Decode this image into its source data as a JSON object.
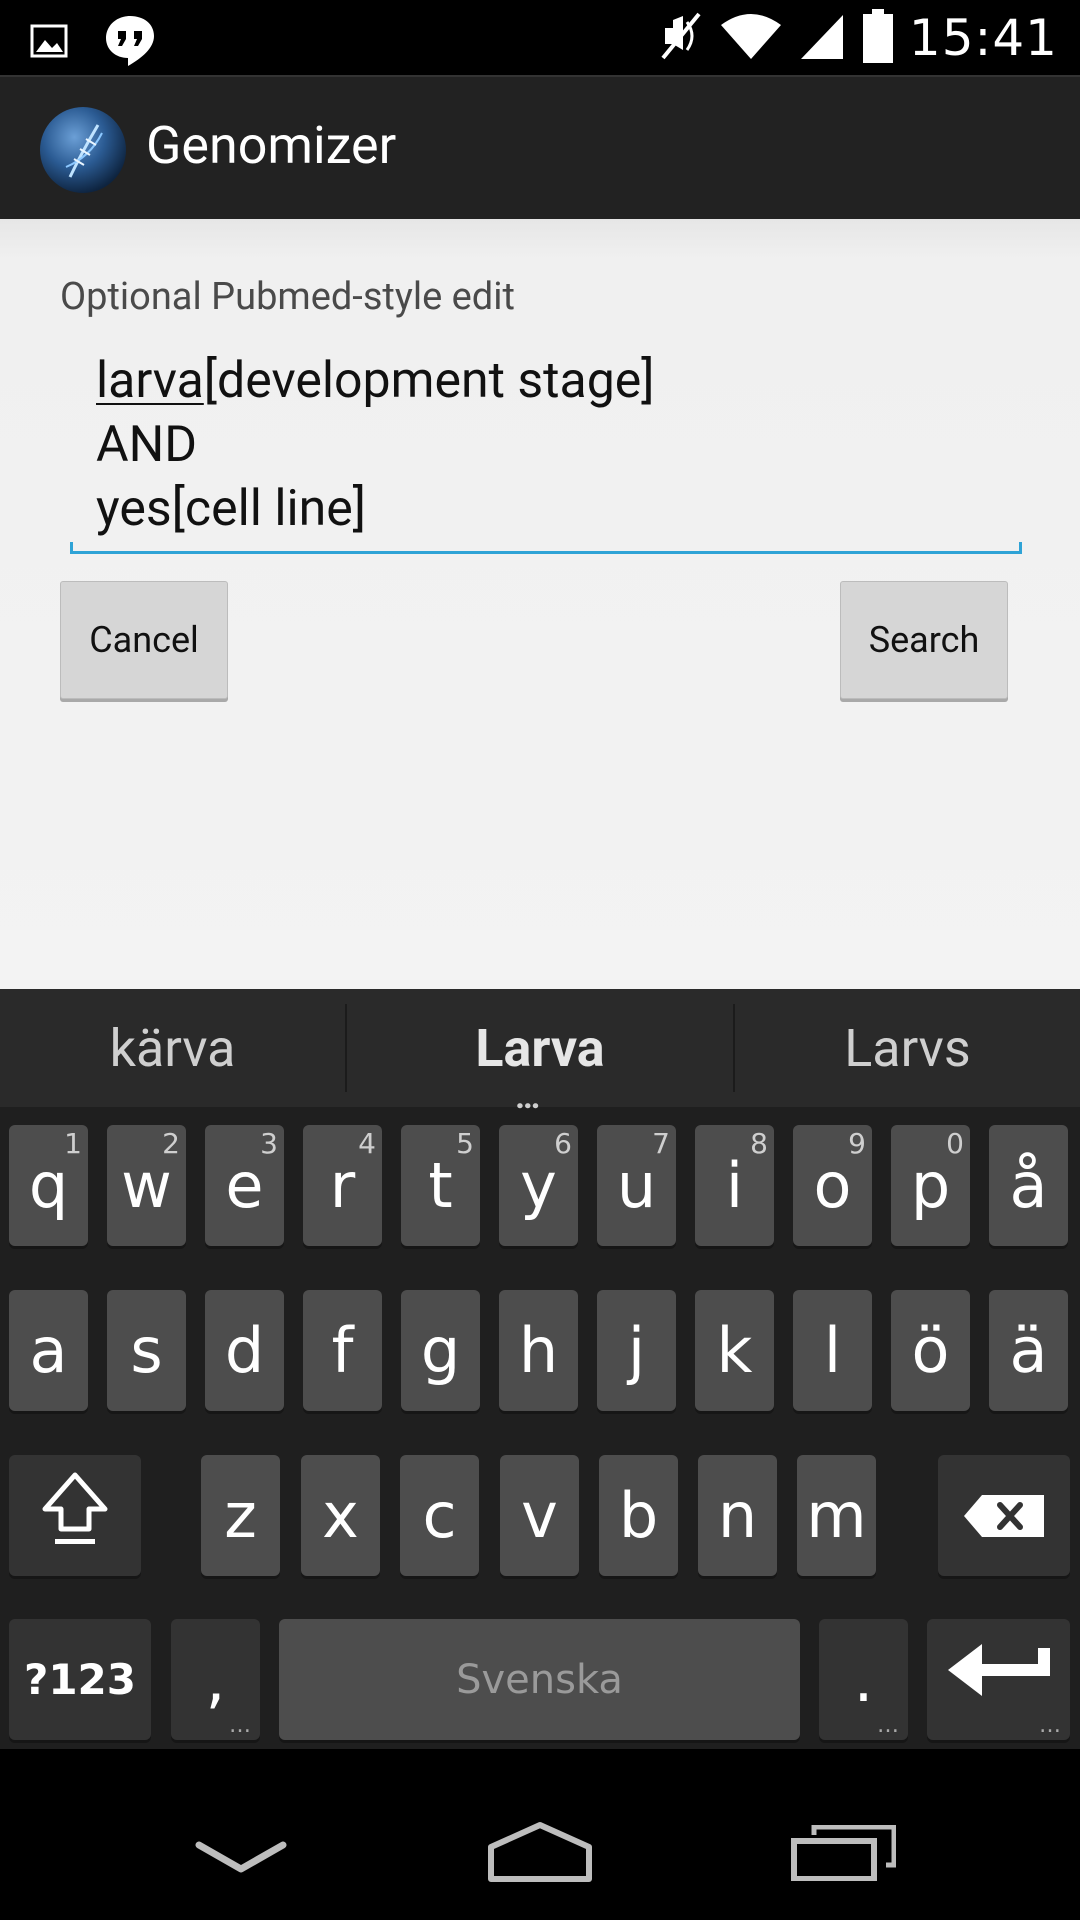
{
  "status_bar": {
    "time": "15:41",
    "left_icons": [
      "image-icon",
      "hangouts-icon"
    ],
    "right_icons": [
      "mute-icon",
      "wifi-icon",
      "signal-icon",
      "battery-icon"
    ]
  },
  "app": {
    "title": "Genomizer"
  },
  "form": {
    "label": "Optional Pubmed-style edit",
    "query_line1_word": "larva",
    "query_line1_rest": "[development stage]",
    "query_line2": "AND",
    "query_line3": "yes[cell line]",
    "cancel_label": "Cancel",
    "search_label": "Search"
  },
  "keyboard": {
    "suggestions": [
      "kärva",
      "Larva",
      "Larvs"
    ],
    "suggestion_more": "…",
    "row1": [
      {
        "key": "q",
        "hint": "1"
      },
      {
        "key": "w",
        "hint": "2"
      },
      {
        "key": "e",
        "hint": "3"
      },
      {
        "key": "r",
        "hint": "4"
      },
      {
        "key": "t",
        "hint": "5"
      },
      {
        "key": "y",
        "hint": "6"
      },
      {
        "key": "u",
        "hint": "7"
      },
      {
        "key": "i",
        "hint": "8"
      },
      {
        "key": "o",
        "hint": "9"
      },
      {
        "key": "p",
        "hint": "0"
      },
      {
        "key": "å",
        "hint": ""
      }
    ],
    "row2": [
      "a",
      "s",
      "d",
      "f",
      "g",
      "h",
      "j",
      "k",
      "l",
      "ö",
      "ä"
    ],
    "row3": [
      "z",
      "x",
      "c",
      "v",
      "b",
      "n",
      "m"
    ],
    "symbols_label": "?123",
    "comma_label": ",",
    "space_label": "Svenska",
    "period_label": ".",
    "colors": {
      "key_bg": "#4d4d4d",
      "accent": "#2fa3d6"
    }
  },
  "nav_bar": {
    "icons": [
      "back-icon",
      "home-icon",
      "recents-icon"
    ]
  }
}
